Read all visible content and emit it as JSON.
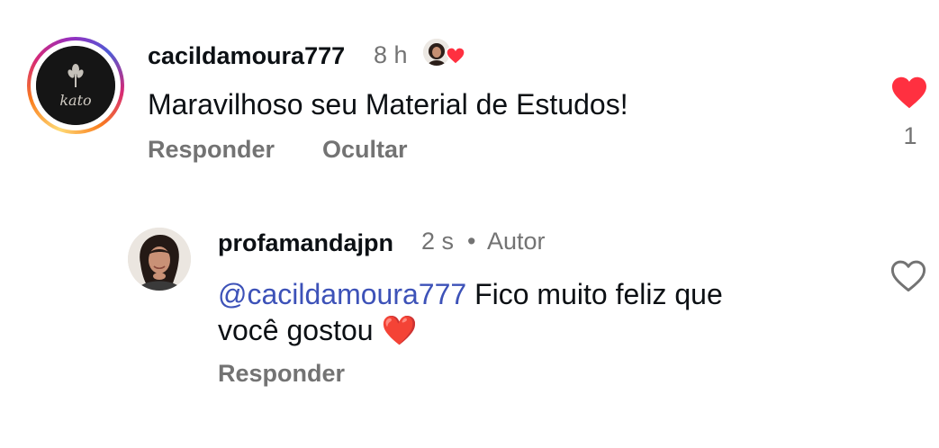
{
  "comments": [
    {
      "username": "cacildamoura777",
      "time": "8 h",
      "text": "Maravilhoso seu Material de Estudos!",
      "actions": {
        "reply": "Responder",
        "hide": "Ocultar"
      },
      "like_count": "1",
      "liked": true,
      "liked_by_author": true,
      "avatar_icon": "logo-avatar",
      "avatar_logo_text": "kato"
    },
    {
      "username": "profamandajpn",
      "time": "2 s",
      "separator": "•",
      "badge": "Autor",
      "mention": "@cacildamoura777",
      "text_line1": " Fico muito feliz que",
      "text_line2": "você gostou",
      "emoji": "❤️",
      "actions": {
        "reply": "Responder"
      },
      "liked": false,
      "avatar_icon": "profile-photo"
    }
  ],
  "colors": {
    "like_red": "#ff3040",
    "secondary_text": "#737373",
    "mention_blue": "#3d52b8",
    "primary_text": "#0c1014"
  }
}
